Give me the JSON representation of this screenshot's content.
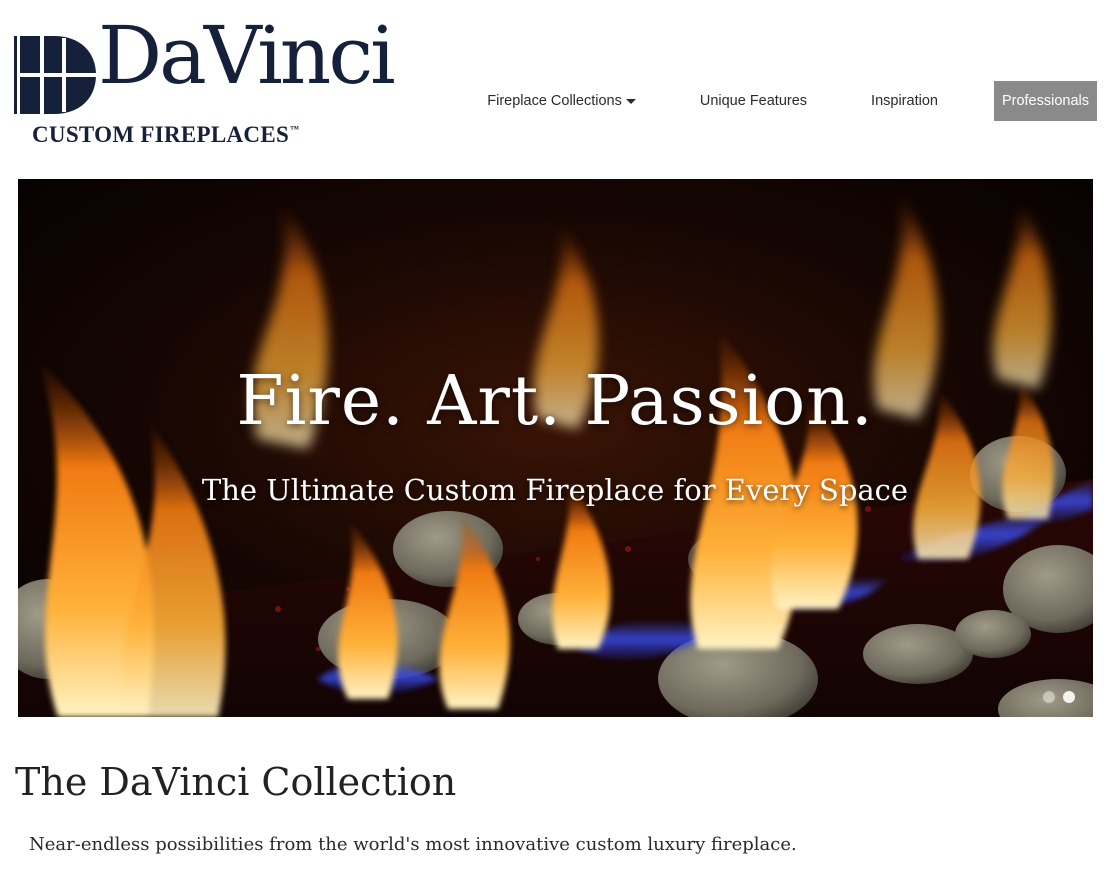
{
  "brand": {
    "name": "DaVinci",
    "tagline": "CUSTOM FIREPLACES",
    "trademark": "™",
    "color": "#15213a"
  },
  "nav": {
    "items": [
      {
        "label": "Fireplace Collections",
        "has_dropdown": true
      },
      {
        "label": "Unique Features"
      },
      {
        "label": "Inspiration"
      }
    ],
    "professionals_label": "Professionals",
    "professionals_bg": "#8a8a8a"
  },
  "hero": {
    "title": "Fire. Art. Passion.",
    "subtitle": "The Ultimate Custom Fireplace for Every Space",
    "slide_count": 2,
    "active_slide": 2
  },
  "section": {
    "title": "The DaVinci Collection",
    "description": "Near-endless possibilities from the world's most innovative custom luxury fireplace."
  }
}
